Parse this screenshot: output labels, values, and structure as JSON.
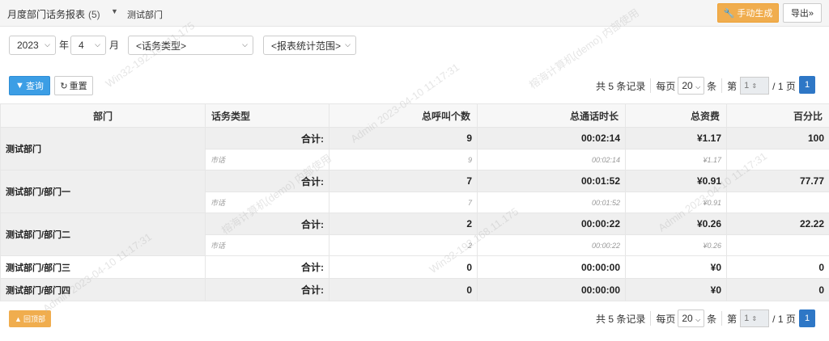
{
  "header": {
    "title": "月度部门话务报表",
    "count": "(5)",
    "department": "测试部门",
    "generate_label": "手动生成",
    "export_label": "导出»"
  },
  "filters": {
    "year": "2023",
    "year_unit": "年",
    "month": "4",
    "month_unit": "月",
    "call_type": "<话务类型>",
    "scope": "<报表统计范围>"
  },
  "actions": {
    "query_label": "查询",
    "reset_label": "重置"
  },
  "pager": {
    "total_text": "共 5 条记录",
    "per_page_prefix": "每页",
    "per_page": "20",
    "per_page_suffix": "条",
    "page_prefix": "第",
    "current_page": "1",
    "page_suffix": "/ 1 页",
    "page_button": "1"
  },
  "table": {
    "columns": [
      "部门",
      "话务类型",
      "总呼叫个数",
      "总通话时长",
      "总资费",
      "百分比"
    ],
    "total_label": "合计:",
    "rows": [
      {
        "dept": "测试部门",
        "total": {
          "calls": "9",
          "duration": "00:02:14",
          "fee": "¥1.17",
          "percent": "100"
        },
        "sub": {
          "type": "市话",
          "calls": "9",
          "duration": "00:02:14",
          "fee": "¥1.17"
        }
      },
      {
        "dept": "测试部门/部门一",
        "total": {
          "calls": "7",
          "duration": "00:01:52",
          "fee": "¥0.91",
          "percent": "77.77"
        },
        "sub": {
          "type": "市话",
          "calls": "7",
          "duration": "00:01:52",
          "fee": "¥0.91"
        }
      },
      {
        "dept": "测试部门/部门二",
        "total": {
          "calls": "2",
          "duration": "00:00:22",
          "fee": "¥0.26",
          "percent": "22.22"
        },
        "sub": {
          "type": "市话",
          "calls": "2",
          "duration": "00:00:22",
          "fee": "¥0.26"
        }
      },
      {
        "dept": "测试部门/部门三",
        "total": {
          "calls": "0",
          "duration": "00:00:00",
          "fee": "¥0",
          "percent": "0"
        }
      },
      {
        "dept": "测试部门/部门四",
        "total": {
          "calls": "0",
          "duration": "00:00:00",
          "fee": "¥0",
          "percent": "0"
        }
      }
    ]
  },
  "footer": {
    "back_top_label": "回顶部"
  },
  "watermark": {
    "line1": "Admin 2023-04-10 11:17:31",
    "line2": "Win32-192.168.11.175",
    "line3": "榕海计算机(demo) 内部使用"
  },
  "colors": {
    "accent_orange": "#f0ad4e",
    "accent_blue": "#3c9ee5",
    "page_blue": "#2e77c6"
  }
}
